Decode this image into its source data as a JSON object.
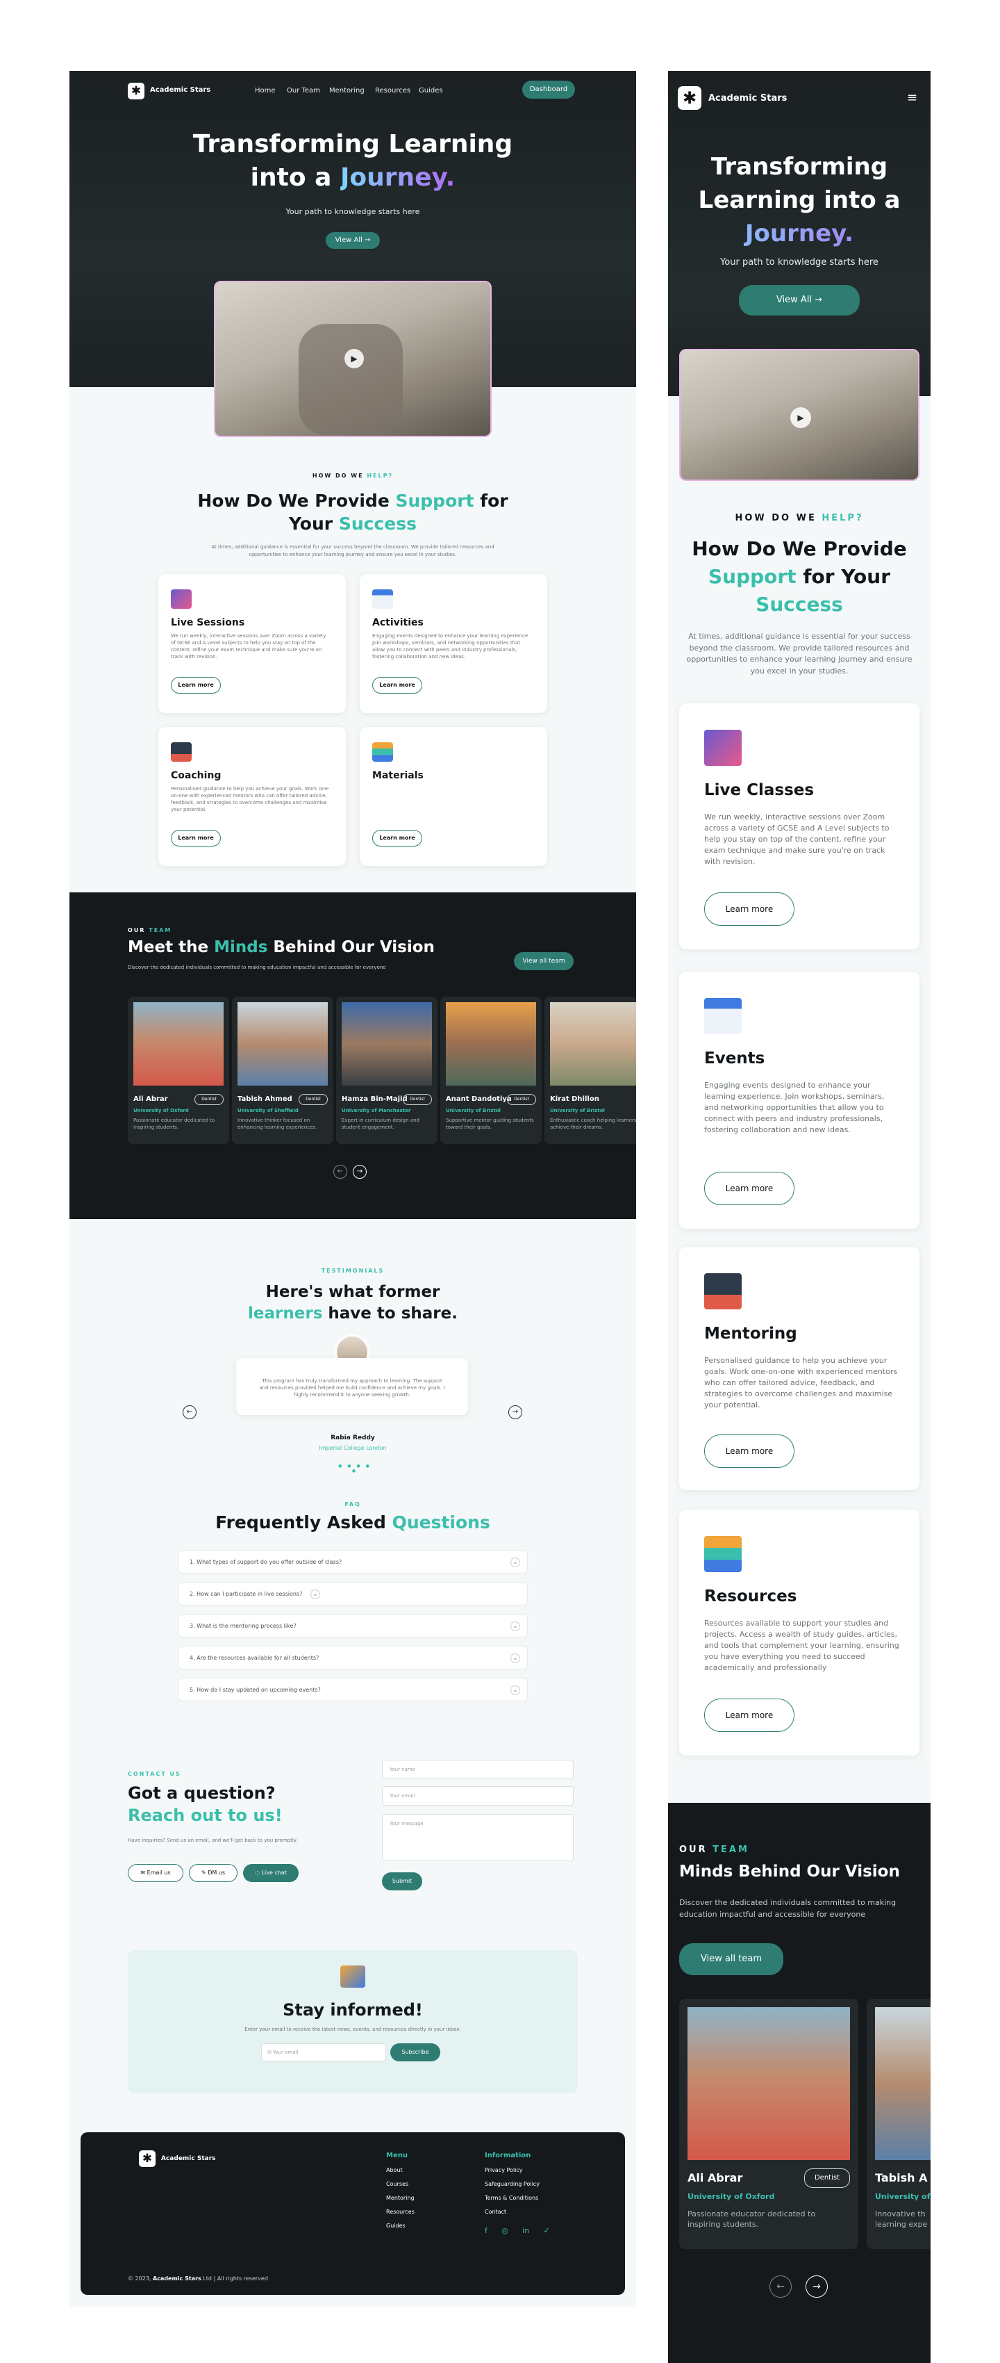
{
  "brand": {
    "name": "Academic Stars",
    "accent": "#3bbfad",
    "dark": "#14171a",
    "primary": "#2e7c72"
  },
  "nav": {
    "links": [
      "Home",
      "Our Team",
      "Mentoring",
      "Resources",
      "Guides"
    ],
    "dashboard": "Dashboard"
  },
  "hero": {
    "line1": "Transforming Learning",
    "line2_prefix": "into a ",
    "line2_highlight": "Journey.",
    "subtitle": "Your path to knowledge starts here",
    "cta": "View All →"
  },
  "support": {
    "eyebrow_prefix": "HOW DO WE ",
    "eyebrow_highlight": "HELP?",
    "title_pre": "How Do We Provide ",
    "title_support": "Support",
    "title_mid": " for",
    "title_your": "Your ",
    "title_success": "Success",
    "mobile_title_mid": " for Your",
    "description_desktop": "At times, additional guidance is essential for your success beyond the classroom. We provide tailored resources and opportunities to enhance your learning journey and ensure you excel in your studies.",
    "description_mobile": "At times, additional guidance is essential for your success beyond the classroom. We provide tailored resources and opportunities to enhance your learning journey and ensure you excel in your studies.",
    "learn_more": "Learn more",
    "cards_desktop": [
      {
        "icon": "video-grid-icon",
        "title": "Live Sessions",
        "text": "We run weekly, interactive sessions over Zoom across a variety of GCSE and A Level subjects to help you stay on top of the content, refine your exam technique and make sure you're on track with revision."
      },
      {
        "icon": "calendar-check-icon",
        "title": "Activities",
        "text": "Engaging events designed to enhance your learning experience. Join workshops, seminars, and networking opportunities that allow you to connect with peers and industry professionals, fostering collaboration and new ideas."
      },
      {
        "icon": "mentor-icon",
        "title": "Coaching",
        "text": "Personalised guidance to help you achieve your goals. Work one-on-one with experienced mentors who can offer tailored advice, feedback, and strategies to overcome challenges and maximise your potential."
      },
      {
        "icon": "books-icon",
        "title": "Materials",
        "text": ""
      }
    ],
    "cards_mobile": [
      {
        "icon": "video-grid-icon",
        "title": "Live Classes",
        "text": "We run weekly, interactive sessions over Zoom across a variety of GCSE and A Level subjects to help you stay on top of the content, refine your exam technique and make sure you're on track with revision."
      },
      {
        "icon": "calendar-check-icon",
        "title": "Events",
        "text": "Engaging events designed to enhance your learning experience. Join workshops, seminars, and networking opportunities that allow you to connect with peers and industry professionals, fostering collaboration and new ideas."
      },
      {
        "icon": "mentor-icon",
        "title": "Mentoring",
        "text": "Personalised guidance to help you achieve your goals. Work one-on-one with experienced mentors who can offer tailored advice, feedback, and strategies to overcome challenges and maximise your potential."
      },
      {
        "icon": "books-icon",
        "title": "Resources",
        "text": "Resources available to support your studies and projects. Access a wealth of study guides, articles, and tools that complement your learning, ensuring you have everything you need to succeed academically and professionally"
      }
    ]
  },
  "team": {
    "eyebrow_prefix": "OUR ",
    "eyebrow_highlight": "TEAM",
    "title_pre": "Meet the ",
    "title_highlight": "Minds",
    "title_post": " Behind Our Vision",
    "mobile_title": "Minds Behind Our Vision",
    "description": "Discover the dedicated individuals committed to making education impactful and accessible for everyone",
    "view_all": "View all team",
    "members": [
      {
        "name": "Ali Abrar",
        "role": "Dentist",
        "university": "University of Oxford",
        "bio": "Passionate educator dedicated to inspiring students."
      },
      {
        "name": "Tabish Ahmed",
        "role": "Dentist",
        "university": "University of Sheffield",
        "bio": "Innovative thinker focused on enhancing learning experiences."
      },
      {
        "name": "Hamza Bin-Majid",
        "role": "Dentist",
        "university": "University of Manchester",
        "bio": "Expert in curriculum design and student engagement."
      },
      {
        "name": "Anant Dandotiya",
        "role": "Dentist",
        "university": "University of Bristol",
        "bio": "Supportive mentor guiding students toward their goals."
      },
      {
        "name": "Kirat Dhillon",
        "role": "Dentist",
        "university": "University of Bristol",
        "bio": "Enthusiastic coach helping learners achieve their dreams."
      }
    ],
    "mobile_partial_name": "Tabish A",
    "mobile_partial_univ": "University of",
    "mobile_partial_bio": "Innovative th learning expe"
  },
  "testimonials": {
    "eyebrow": "TESTIMONIALS",
    "title_line1": "Here's what former",
    "title_highlight": "learners",
    "title_post": " have to share.",
    "quote": "This program has truly transformed my approach to learning. The support and resources provided helped me build confidence and achieve my goals. I highly recommend it to anyone seeking growth.",
    "name": "Rabia Reddy",
    "school": "Imperial College London"
  },
  "faq": {
    "eyebrow": "FAQ",
    "title_pre": "Frequently Asked ",
    "title_highlight": "Questions",
    "items": [
      "1. What types of support do you offer outside of class?",
      "2. How can I participate in live sessions?",
      "3. What is the mentoring process like?",
      "4. Are the resources available for all students?",
      "5. How do I stay updated on upcoming events?"
    ]
  },
  "contact": {
    "eyebrow": "CONTACT US",
    "title1": "Got a question?",
    "title2": "Reach out to us!",
    "description": "Have inquiries? Send us an email, and we'll get back to you promptly.",
    "buttons": [
      "Email us",
      "DM us",
      "Live chat"
    ],
    "placeholders": {
      "name": "Your name",
      "email": "Your email",
      "message": "Your message"
    },
    "submit": "Submit"
  },
  "newsletter": {
    "title": "Stay informed!",
    "description": "Enter your email to receive the latest news, events, and resources directly in your inbox.",
    "placeholder": "Your email",
    "subscribe": "Subscribe"
  },
  "footer": {
    "menu_title": "Menu",
    "menu": [
      "About",
      "Courses",
      "Mentoring",
      "Resources",
      "Guides"
    ],
    "info_title": "Information",
    "info": [
      "Privacy Policy",
      "Safeguarding Policy",
      "Terms & Conditions",
      "Contact"
    ],
    "copyright_pre": "© 2023, ",
    "copyright_brand": "Academic Stars",
    "copyright_post": " Ltd | All rights reserved"
  }
}
